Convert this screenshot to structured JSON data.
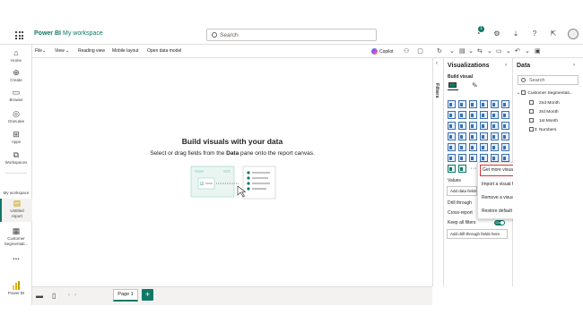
{
  "topbar": {
    "app_name": "Power BI",
    "workspace": "My workspace",
    "search_placeholder": "Search",
    "notification_count": "1"
  },
  "leftnav": {
    "items": [
      {
        "label": "Home",
        "icon": "home-icon"
      },
      {
        "label": "Create",
        "icon": "plus-circle-icon"
      },
      {
        "label": "Browse",
        "icon": "folder-icon"
      },
      {
        "label": "OneLake",
        "icon": "onelake-icon"
      },
      {
        "label": "Apps",
        "icon": "apps-icon"
      },
      {
        "label": "Workspaces",
        "icon": "workspaces-icon"
      },
      {
        "label": "My workspace",
        "icon": "workspace-icon"
      },
      {
        "label": "Untitled report",
        "icon": "report-icon"
      },
      {
        "label": "Customer Segmentati...",
        "icon": "semantic-model-icon"
      },
      {
        "label": "...",
        "icon": "more-icon"
      },
      {
        "label": "Power BI",
        "icon": "powerbi-logo"
      }
    ]
  },
  "menubar": {
    "file": "File",
    "view": "View",
    "reading_view": "Reading view",
    "mobile_layout": "Mobile layout",
    "open_data_model": "Open data model",
    "copilot": "Copilot"
  },
  "canvas": {
    "title": "Build visuals with your data",
    "subtitle_pre": "Select or drag fields from the ",
    "subtitle_bold": "Data",
    "subtitle_post": " pane onto the report canvas."
  },
  "bottombar": {
    "page_tab": "Page 1",
    "add_page": "+"
  },
  "filters": {
    "label": "Filters"
  },
  "visualizations": {
    "title": "Visualizations",
    "build_label": "Build visual",
    "values_label": "Values",
    "add_data_fields": "Add data fields here",
    "drill_through": "Drill through",
    "cross_report": "Cross-report",
    "keep_all_filters": "Keep all filters",
    "toggle_label": "On",
    "add_drill_through": "Add drill-through fields here"
  },
  "context_menu": {
    "items": [
      "Get more visuals",
      "Import a visual from a file",
      "Remove a visual",
      "Restore default visuals"
    ]
  },
  "data_pane": {
    "title": "Data",
    "search_placeholder": "Search",
    "table_name": "Customer Segmentati...",
    "fields": [
      "2nd Month",
      "3rd Month",
      "1st Month",
      "Numbers"
    ]
  },
  "colors": {
    "accent": "#117865",
    "highlight_border": "#d13438"
  }
}
